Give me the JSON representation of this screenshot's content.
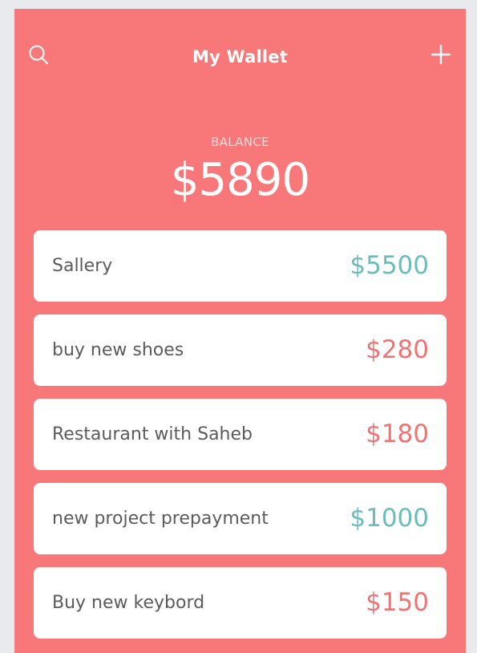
{
  "header": {
    "title": "My Wallet",
    "search_icon": "search-icon",
    "add_icon": "plus-icon"
  },
  "balance": {
    "label": "BALANCE",
    "value": "$5890"
  },
  "transactions": [
    {
      "title": "Sallery",
      "amount": "$5500",
      "type": "income"
    },
    {
      "title": "buy new shoes",
      "amount": "$280",
      "type": "expense"
    },
    {
      "title": "Restaurant with Saheb",
      "amount": "$180",
      "type": "expense"
    },
    {
      "title": "new project prepayment",
      "amount": "$1000",
      "type": "income"
    },
    {
      "title": "Buy new keybord",
      "amount": "$150",
      "type": "expense"
    }
  ],
  "colors": {
    "background": "#f8787a",
    "income": "#6cbcbc",
    "expense": "#ef7373",
    "page_background": "#e8eaed"
  }
}
